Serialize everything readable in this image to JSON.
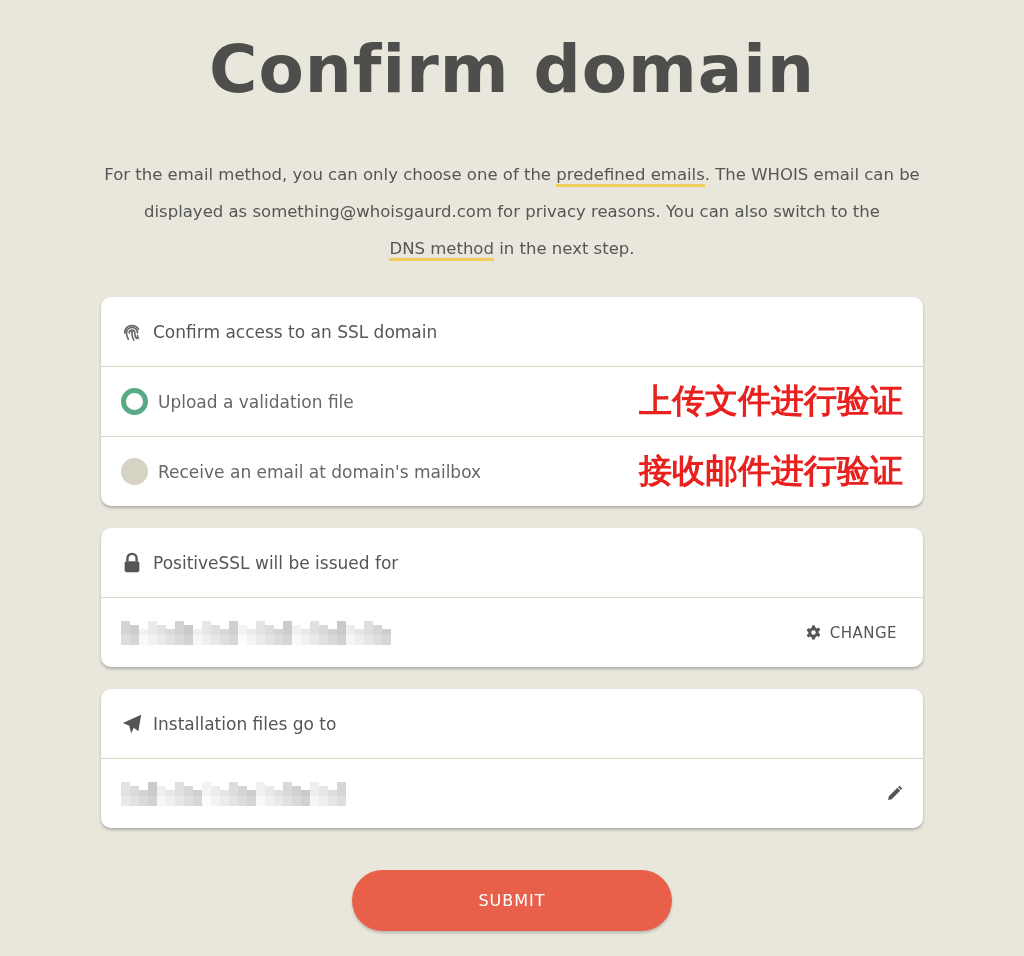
{
  "title": "Confirm domain",
  "intro": [
    {
      "text": "For the email method, you can only choose one of the ",
      "kind": "text"
    },
    {
      "text": "predefined emails",
      "kind": "link"
    },
    {
      "text": ". The WHOIS email can be displayed as something@whoisgaurd.com for privacy reasons. You can also switch to the ",
      "kind": "text"
    },
    {
      "text": "DNS method",
      "kind": "link"
    },
    {
      "text": " in the next step.",
      "kind": "text"
    }
  ],
  "method_card": {
    "header": "Confirm access to an SSL domain",
    "options": [
      {
        "label": "Upload a validation file",
        "selected": true,
        "annotation": "上传文件进行验证"
      },
      {
        "label": "Receive an email at domain's mailbox",
        "selected": false,
        "annotation": "接收邮件进行验证"
      }
    ]
  },
  "domain_card": {
    "header": "PositiveSSL will be issued for",
    "action": "CHANGE"
  },
  "files_card": {
    "header": "Installation files go to"
  },
  "submit": "SUBMIT"
}
